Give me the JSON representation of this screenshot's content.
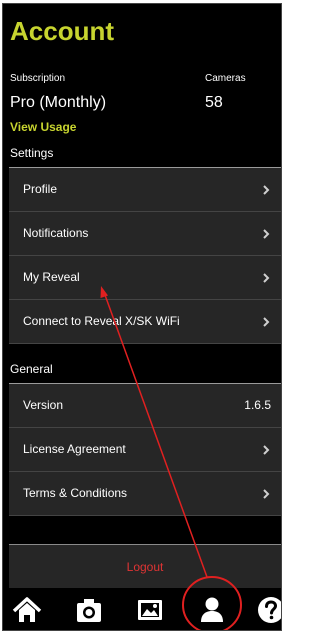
{
  "header": {
    "title": "Account"
  },
  "subscription": {
    "label": "Subscription",
    "value": "Pro (Monthly)",
    "view_usage": "View Usage"
  },
  "cameras": {
    "label": "Cameras",
    "value": "58"
  },
  "settings": {
    "heading": "Settings",
    "items": [
      {
        "label": "Profile"
      },
      {
        "label": "Notifications"
      },
      {
        "label": "My Reveal"
      },
      {
        "label": "Connect to Reveal X/SK WiFi"
      }
    ]
  },
  "general": {
    "heading": "General",
    "version": {
      "label": "Version",
      "value": "1.6.5"
    },
    "items": [
      {
        "label": "License Agreement"
      },
      {
        "label": "Terms & Conditions"
      }
    ]
  },
  "logout": {
    "label": "Logout"
  },
  "tabs": [
    {
      "icon": "home-icon"
    },
    {
      "icon": "camera-icon"
    },
    {
      "icon": "image-icon"
    },
    {
      "icon": "account-icon",
      "active": true
    },
    {
      "icon": "help-icon"
    }
  ],
  "annotation": {
    "color": "#e02020"
  },
  "colors": {
    "accent": "#c7d42f",
    "background": "#000000",
    "row": "#262626",
    "logout": "#e03434"
  }
}
